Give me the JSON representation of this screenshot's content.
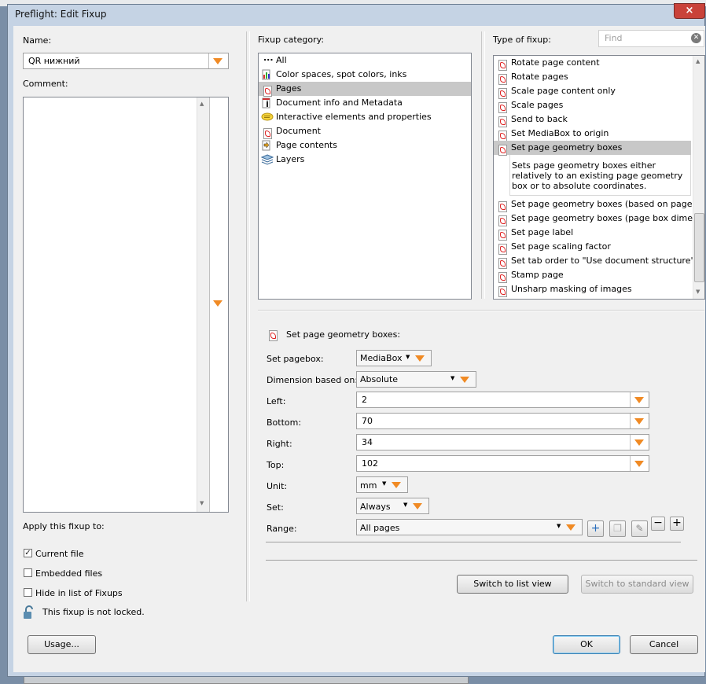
{
  "window": {
    "title": "Preflight: Edit Fixup",
    "close_label": "×"
  },
  "left": {
    "name_label": "Name:",
    "name_value": "QR нижний",
    "comment_label": "Comment:",
    "apply_label": "Apply this fixup to:",
    "options": [
      {
        "label": "Current file",
        "checked": true
      },
      {
        "label": "Embedded files",
        "checked": false
      },
      {
        "label": "Hide in list of Fixups",
        "checked": false
      }
    ],
    "lock_text": "This fixup is not locked."
  },
  "category": {
    "label": "Fixup category:",
    "items": [
      {
        "label": "All",
        "icon": "dots-icon"
      },
      {
        "label": "Color spaces, spot colors, inks",
        "icon": "color-icon"
      },
      {
        "label": "Pages",
        "icon": "pdf-icon",
        "selected": true
      },
      {
        "label": "Document info and Metadata",
        "icon": "info-icon"
      },
      {
        "label": "Interactive elements and properties",
        "icon": "comment-icon"
      },
      {
        "label": "Document",
        "icon": "pdf-icon"
      },
      {
        "label": "Page contents",
        "icon": "arrow-icon"
      },
      {
        "label": "Layers",
        "icon": "layers-icon"
      }
    ]
  },
  "type": {
    "label": "Type of fixup:",
    "find_placeholder": "Find",
    "items_top": [
      "Rotate page content",
      "Rotate pages",
      "Scale page content only",
      "Scale pages",
      "Send to back",
      "Set MediaBox to origin"
    ],
    "selected": "Set page geometry boxes",
    "description": "Sets page geometry boxes either relatively to an existing page geometry box or to absolute coordinates.",
    "items_bottom": [
      "Set page geometry boxes (based on page con",
      "Set page geometry boxes (page box dimensio",
      "Set page label",
      "Set page scaling factor",
      "Set tab order to \"Use document structure\"",
      "Stamp page",
      "Unsharp masking of images"
    ]
  },
  "settings": {
    "header": "Set page geometry boxes:",
    "set_pagebox_label": "Set pagebox:",
    "set_pagebox_value": "MediaBox",
    "dimension_label": "Dimension based on:",
    "dimension_value": "Absolute",
    "left_label": "Left:",
    "left_value": "2",
    "bottom_label": "Bottom:",
    "bottom_value": "70",
    "right_label": "Right:",
    "right_value": "34",
    "top_label": "Top:",
    "top_value": "102",
    "unit_label": "Unit:",
    "unit_value": "mm",
    "set_label": "Set:",
    "set_value": "Always",
    "range_label": "Range:",
    "range_value": "All pages"
  },
  "buttons": {
    "switch_list": "Switch to list view",
    "switch_standard": "Switch to standard view",
    "usage": "Usage...",
    "ok": "OK",
    "cancel": "Cancel"
  },
  "colors": {
    "accent_arrow": "#f08a24",
    "selection": "#c8c8c8",
    "close": "#c9423a"
  }
}
